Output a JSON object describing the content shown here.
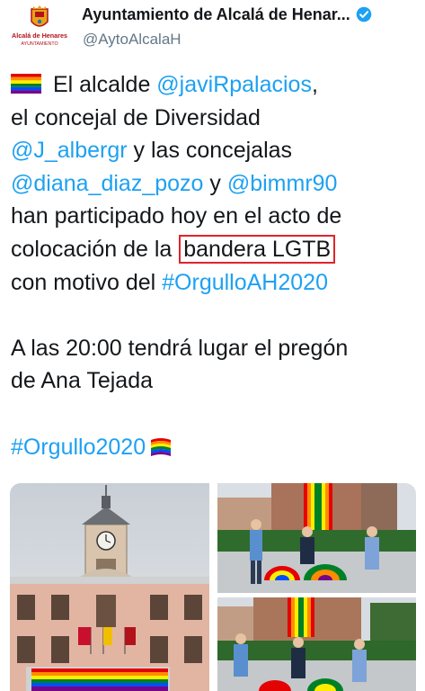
{
  "account": {
    "display_name": "Ayuntamiento de Alcalá de Henar...",
    "handle": "@AytoAlcalaH",
    "logo_text_line1": "Alcalá de Henares",
    "logo_text_line2": "AYUNTAMIENTO",
    "verified_icon": "verified-badge-icon"
  },
  "tweet": {
    "l1_text": " El alcalde ",
    "l1_mention": "@javiRpalacios",
    "l1_end": ",",
    "l2_text": "el concejal de Diversidad",
    "l3_mention": "@J_albergr",
    "l3_text": " y las concejalas",
    "l4_mention1": "@diana_diaz_pozo",
    "l4_text": " y ",
    "l4_mention2": "@bimmr90",
    "l5_text": "han participado hoy en el acto de",
    "l6_text": "colocación de la ",
    "l6_highlight": "bandera LGTB",
    "l7_text": "con motivo del ",
    "l7_hashtag": "#OrgulloAH2020",
    "l8_text": "A las 20:00 tendrá lugar el pregón",
    "l9_text": "de Ana Tejada",
    "l10_hashtag": "#Orgullo2020",
    "highlight_color": "#e0242b",
    "link_color": "#1da1f2"
  },
  "media": {
    "photos": [
      "town-hall-tower-photo",
      "rainbow-flag-group-photo",
      "rainbow-flag-group-photo-2"
    ]
  }
}
